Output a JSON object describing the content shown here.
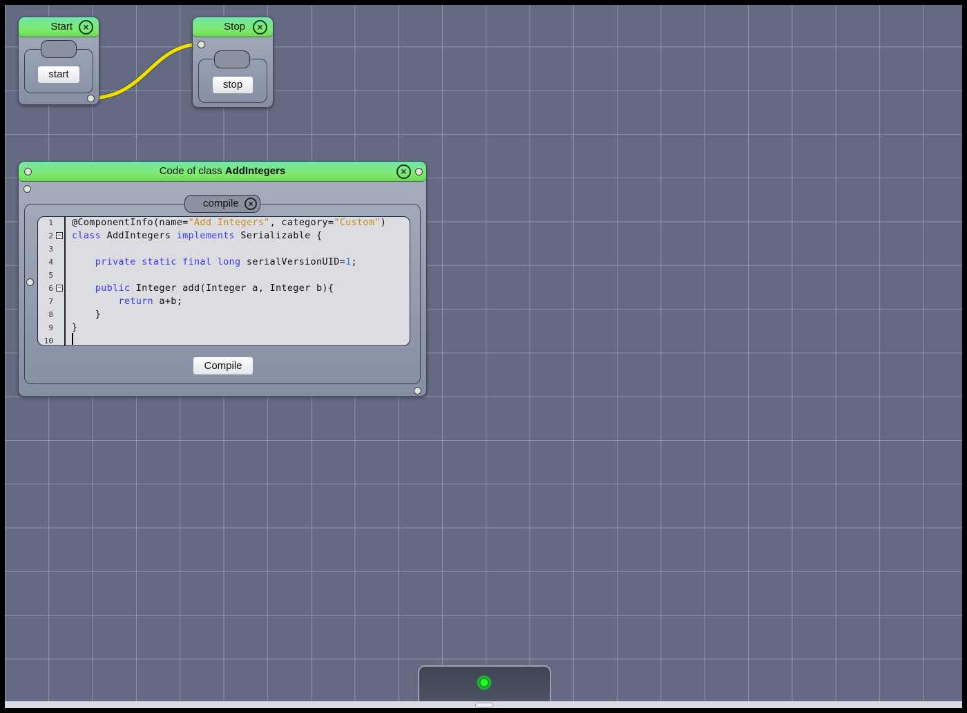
{
  "start_node": {
    "title": "Start",
    "button": "start"
  },
  "stop_node": {
    "title": "Stop",
    "button": "stop"
  },
  "code_window": {
    "title_prefix": "Code of class ",
    "title_class": "AddIntegers",
    "method_tab": "compile",
    "compile_button": "Compile",
    "line_numbers": [
      "1",
      "2",
      "3",
      "4",
      "5",
      "6",
      "7",
      "8",
      "9",
      "10"
    ],
    "code": {
      "l1a": "@ComponentInfo(name=",
      "l1b": "\"Add Integers\"",
      "l1c": ", category=",
      "l1d": "\"Custom\"",
      "l1e": ")",
      "l2a": "class",
      "l2b": " AddIntegers ",
      "l2c": "implements",
      "l2d": " Serializable {",
      "l4a": "    private static final long",
      "l4b": " serialVersionUID=",
      "l4c": "1",
      "l4d": ";",
      "l6a": "    public",
      "l6b": " Integer add(Integer a, Integer b){",
      "l7a": "        return",
      "l7b": " a+b;",
      "l8": "    }",
      "l9": "}"
    }
  },
  "icons": {
    "close": "close-circle-icon",
    "fold": "fold-minus-icon",
    "status": "status-led-icon"
  },
  "colors": {
    "canvas": "#636a82",
    "titlebar": "#7fe868",
    "connection": "#f0e000",
    "status_led": "#22ff22",
    "keyword": "#3a3ae8",
    "string": "#c8861a"
  }
}
